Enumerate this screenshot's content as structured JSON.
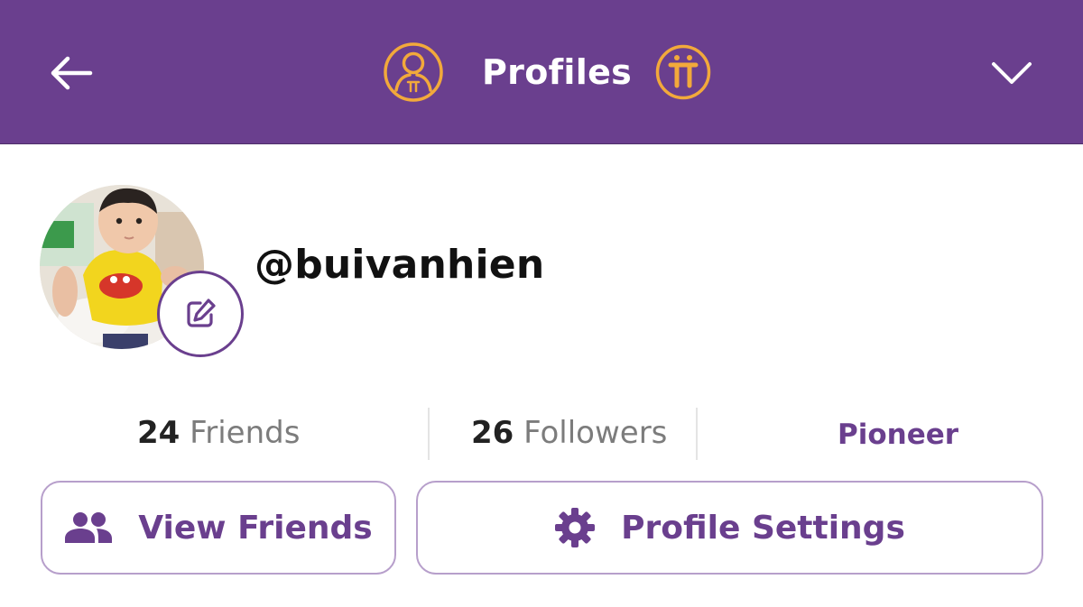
{
  "header": {
    "title": "Profiles",
    "back_icon": "arrow-left-icon",
    "profile_icon": "user-circle-icon",
    "pi_icon": "pi-coin-icon",
    "dropdown_icon": "chevron-down-icon"
  },
  "profile": {
    "username": "@buivanhien",
    "avatar": "baby-photo-avatar",
    "edit_icon": "edit-pencil-icon"
  },
  "stats": {
    "friends_count": "24",
    "friends_label": "Friends",
    "followers_count": "26",
    "followers_label": "Followers",
    "role": "Pioneer"
  },
  "actions": {
    "view_friends": "View Friends",
    "profile_settings": "Profile Settings"
  },
  "colors": {
    "brand_purple": "#6a3f8e",
    "gold": "#f2a93b",
    "button_border": "#b79fcb"
  }
}
